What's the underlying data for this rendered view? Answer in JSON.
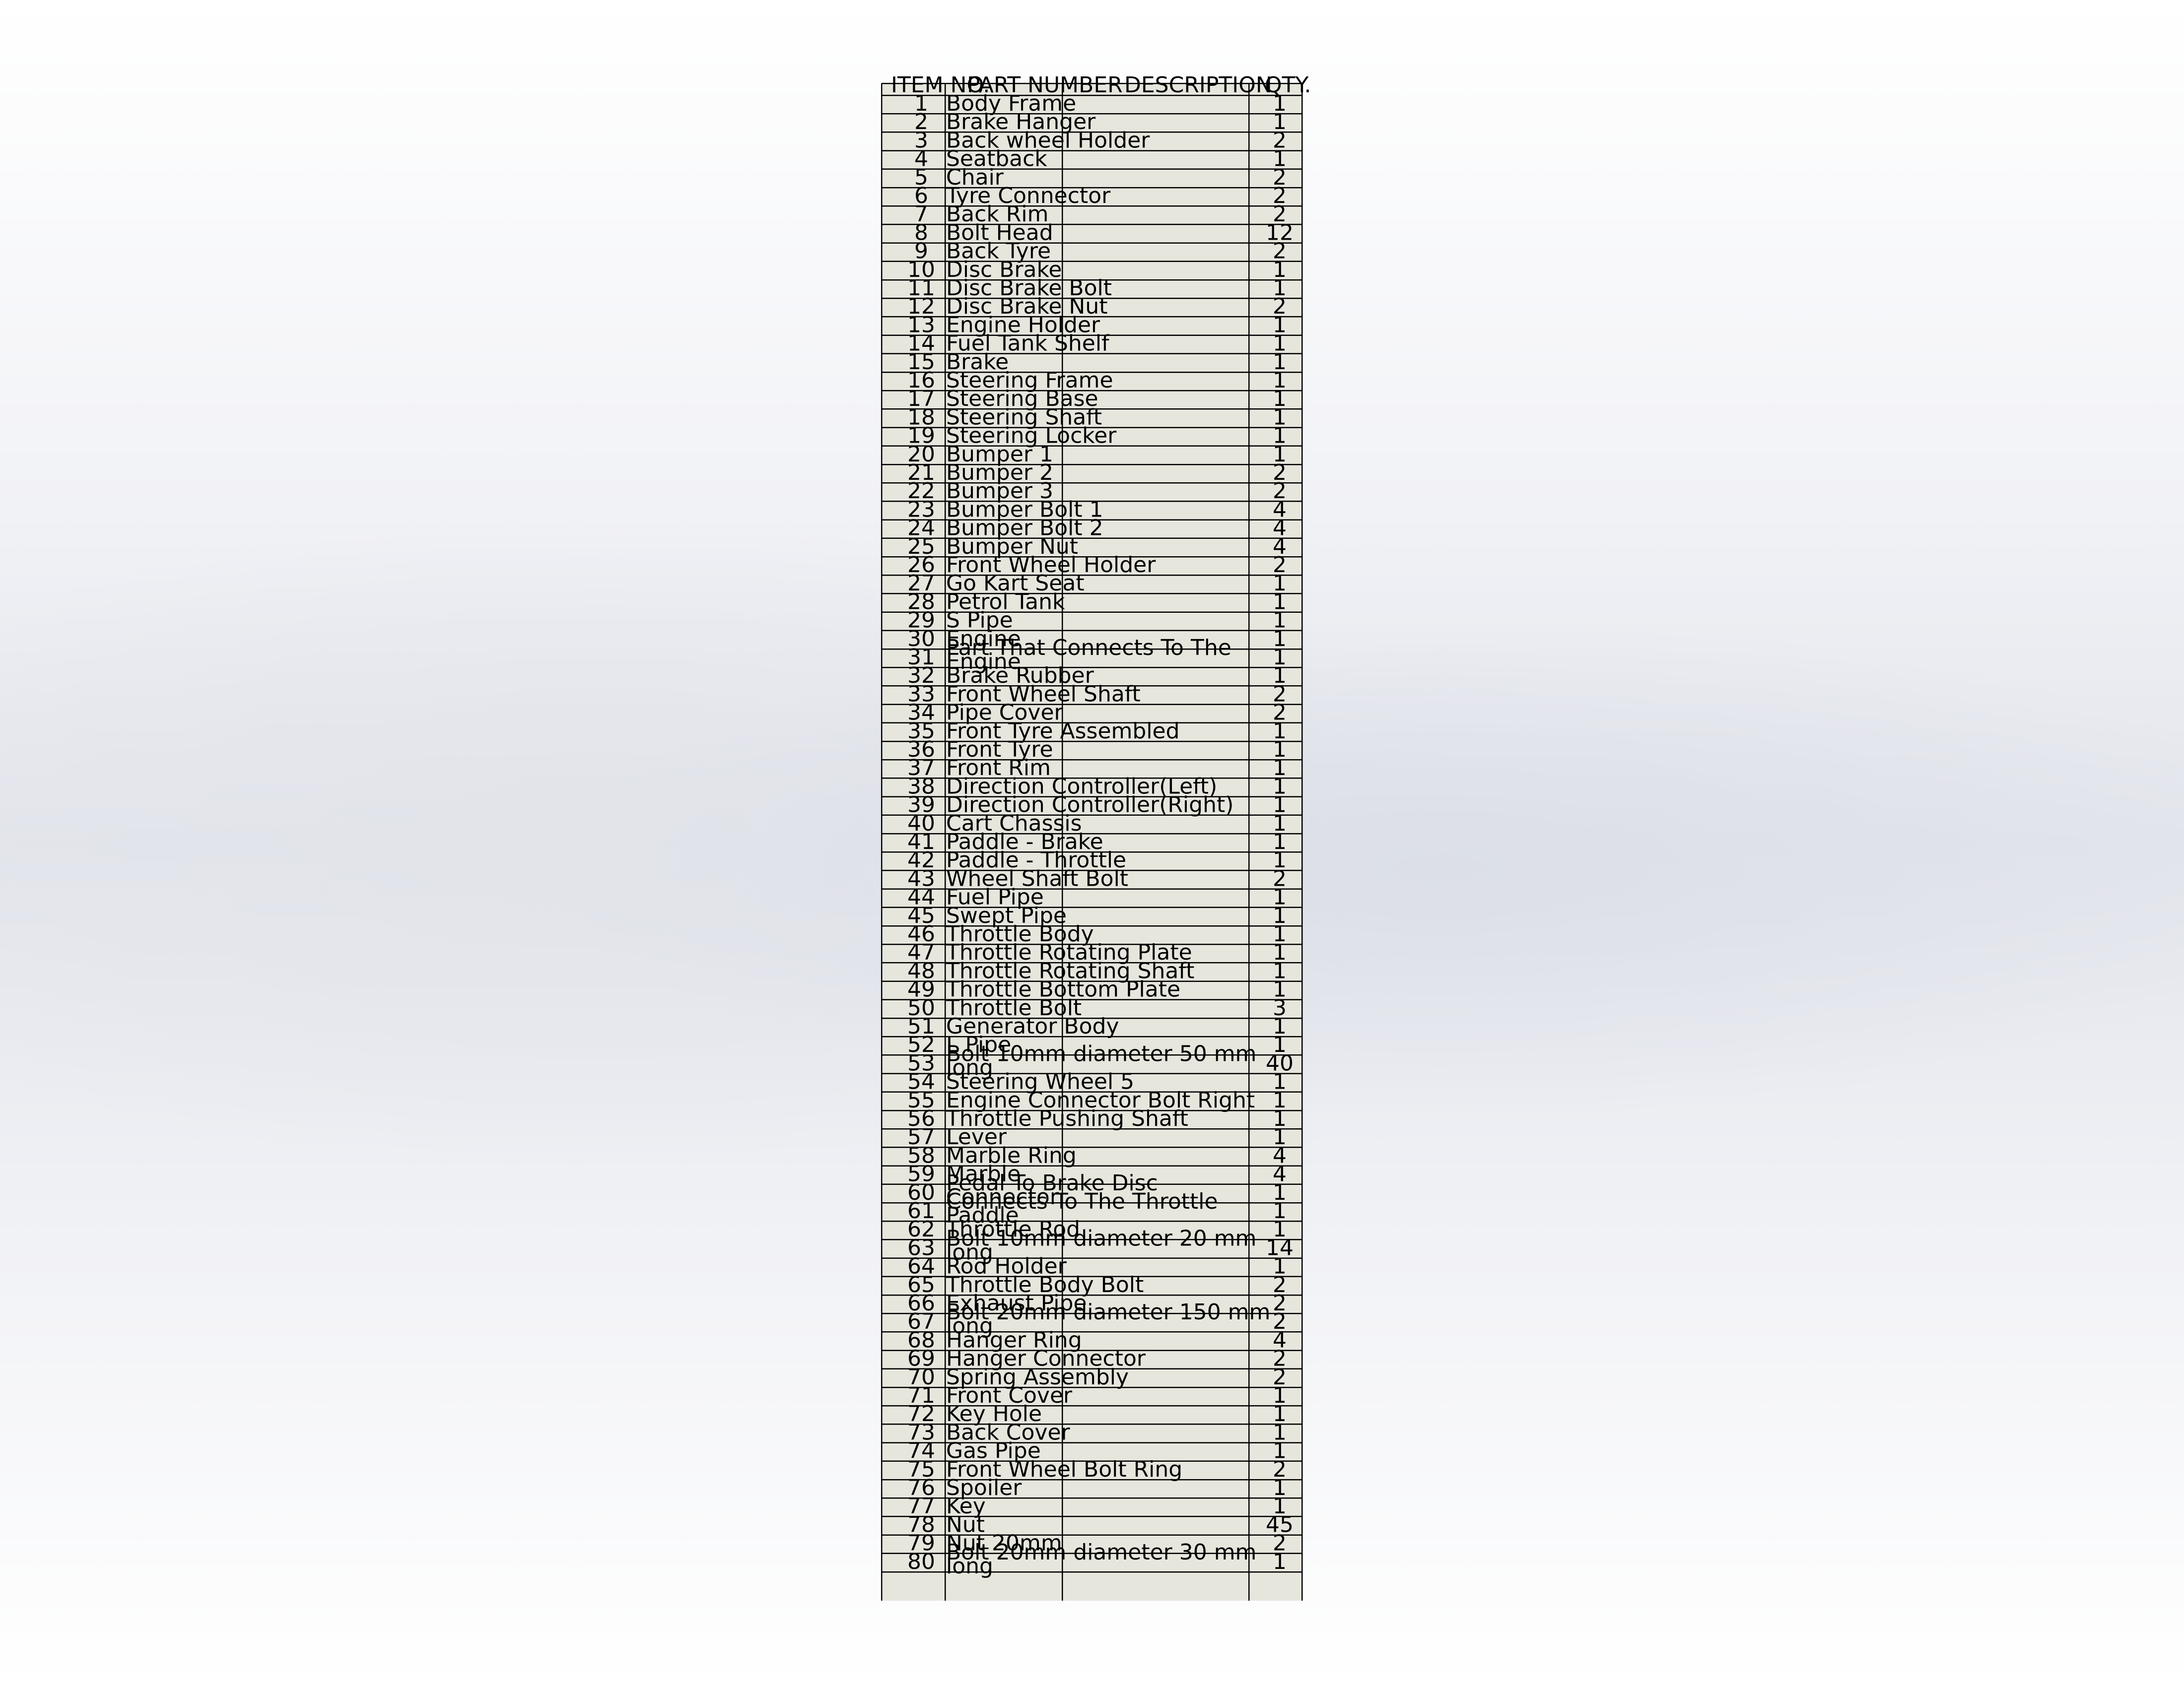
{
  "bom_table": {
    "headers": {
      "item_no": "ITEM NO.",
      "part_number": "PART NUMBER",
      "description": "DESCRIPTION",
      "qty": "QTY."
    },
    "rows": [
      {
        "item": "1",
        "part": "Body Frame",
        "qty": "1"
      },
      {
        "item": "2",
        "part": "Brake Hanger",
        "qty": "1"
      },
      {
        "item": "3",
        "part": "Back wheel Holder",
        "qty": "2"
      },
      {
        "item": "4",
        "part": "Seatback",
        "qty": "1"
      },
      {
        "item": "5",
        "part": "Chair",
        "qty": "2"
      },
      {
        "item": "6",
        "part": "Tyre Connector",
        "qty": "2"
      },
      {
        "item": "7",
        "part": "Back Rim",
        "qty": "2"
      },
      {
        "item": "8",
        "part": "Bolt Head",
        "qty": "12"
      },
      {
        "item": "9",
        "part": "Back Tyre",
        "qty": "2"
      },
      {
        "item": "10",
        "part": "Disc Brake",
        "qty": "1"
      },
      {
        "item": "11",
        "part": "Disc Brake Bolt",
        "qty": "1"
      },
      {
        "item": "12",
        "part": "Disc Brake Nut",
        "qty": "2"
      },
      {
        "item": "13",
        "part": "Engine Holder",
        "qty": "1"
      },
      {
        "item": "14",
        "part": "Fuel Tank Shelf",
        "qty": "1"
      },
      {
        "item": "15",
        "part": "Brake",
        "qty": "1"
      },
      {
        "item": "16",
        "part": "Steering Frame",
        "qty": "1"
      },
      {
        "item": "17",
        "part": "Steering Base",
        "qty": "1"
      },
      {
        "item": "18",
        "part": "Steering Shaft",
        "qty": "1"
      },
      {
        "item": "19",
        "part": "Steering Locker",
        "qty": "1"
      },
      {
        "item": "20",
        "part": "Bumper 1",
        "qty": "1"
      },
      {
        "item": "21",
        "part": "Bumper 2",
        "qty": "2"
      },
      {
        "item": "22",
        "part": "Bumper 3",
        "qty": "2"
      },
      {
        "item": "23",
        "part": "Bumper Bolt 1",
        "qty": "4"
      },
      {
        "item": "24",
        "part": "Bumper Bolt 2",
        "qty": "4"
      },
      {
        "item": "25",
        "part": "Bumper Nut",
        "qty": "4"
      },
      {
        "item": "26",
        "part": "Front Wheel Holder",
        "qty": "2"
      },
      {
        "item": "27",
        "part": "Go Kart Seat",
        "qty": "1"
      },
      {
        "item": "28",
        "part": "Petrol Tank",
        "qty": "1"
      },
      {
        "item": "29",
        "part": "S Pipe",
        "qty": "1"
      },
      {
        "item": "30",
        "part": "Engine",
        "qty": "1"
      },
      {
        "item": "31",
        "part": "Part That Connects To The Engine",
        "qty": "1"
      },
      {
        "item": "32",
        "part": "Brake Rubber",
        "qty": "1"
      },
      {
        "item": "33",
        "part": "Front Wheel Shaft",
        "qty": "2"
      },
      {
        "item": "34",
        "part": "Pipe Cover",
        "qty": "2"
      },
      {
        "item": "35",
        "part": "Front Tyre Assembled",
        "qty": "1"
      },
      {
        "item": "36",
        "part": "Front Tyre",
        "qty": "1"
      },
      {
        "item": "37",
        "part": "Front Rim",
        "qty": "1"
      },
      {
        "item": "38",
        "part": "Direction Controller(Left)",
        "qty": "1"
      },
      {
        "item": "39",
        "part": "Direction Controller(Right)",
        "qty": "1"
      },
      {
        "item": "40",
        "part": "Cart Chassis",
        "qty": "1"
      },
      {
        "item": "41",
        "part": "Paddle - Brake",
        "qty": "1"
      },
      {
        "item": "42",
        "part": "Paddle - Throttle",
        "qty": "1"
      },
      {
        "item": "43",
        "part": "Wheel Shaft Bolt",
        "qty": "2"
      },
      {
        "item": "44",
        "part": "Fuel Pipe",
        "qty": "1"
      },
      {
        "item": "45",
        "part": "Swept Pipe",
        "qty": "1"
      },
      {
        "item": "46",
        "part": "Throttle Body",
        "qty": "1"
      },
      {
        "item": "47",
        "part": "Throttle Rotating Plate",
        "qty": "1"
      },
      {
        "item": "48",
        "part": "Throttle Rotating Shaft",
        "qty": "1"
      },
      {
        "item": "49",
        "part": "Throttle Bottom Plate",
        "qty": "1"
      },
      {
        "item": "50",
        "part": "Throttle Bolt",
        "qty": "3"
      },
      {
        "item": "51",
        "part": "Generator Body",
        "qty": "1"
      },
      {
        "item": "52",
        "part": "L Pipe",
        "qty": "1"
      },
      {
        "item": "53",
        "part": "Bolt 10mm diameter 50 mm long",
        "qty": "40"
      },
      {
        "item": "54",
        "part": "Steering Wheel 5",
        "qty": "1"
      },
      {
        "item": "55",
        "part": "Engine Connector Bolt Right",
        "qty": "1"
      },
      {
        "item": "56",
        "part": "Throttle Pushing Shaft",
        "qty": "1"
      },
      {
        "item": "57",
        "part": "Lever",
        "qty": "1"
      },
      {
        "item": "58",
        "part": "Marble Ring",
        "qty": "4"
      },
      {
        "item": "59",
        "part": "Marble",
        "qty": "4"
      },
      {
        "item": "60",
        "part": "Pedal To Brake Disc Connector",
        "qty": "1"
      },
      {
        "item": "61",
        "part": "Connects To The Throttle Paddle",
        "qty": "1"
      },
      {
        "item": "62",
        "part": "Throttle Rod",
        "qty": "1"
      },
      {
        "item": "63",
        "part": "Bolt 10mm diameter 20 mm long",
        "qty": "14"
      },
      {
        "item": "64",
        "part": "Rod Holder",
        "qty": "1"
      },
      {
        "item": "65",
        "part": "Throttle Body Bolt",
        "qty": "2"
      },
      {
        "item": "66",
        "part": "Exhaust Pipe",
        "qty": "2"
      },
      {
        "item": "67",
        "part": "Bolt 20mm diameter 150 mm long",
        "qty": "2"
      },
      {
        "item": "68",
        "part": "Hanger Ring",
        "qty": "4"
      },
      {
        "item": "69",
        "part": "Hanger Connector",
        "qty": "2"
      },
      {
        "item": "70",
        "part": "Spring Assembly",
        "qty": "2"
      },
      {
        "item": "71",
        "part": "Front Cover",
        "qty": "1"
      },
      {
        "item": "72",
        "part": "Key Hole",
        "qty": "1"
      },
      {
        "item": "73",
        "part": "Back Cover",
        "qty": "1"
      },
      {
        "item": "74",
        "part": "Gas Pipe",
        "qty": "1"
      },
      {
        "item": "75",
        "part": "Front Wheel Bolt Ring",
        "qty": "2"
      },
      {
        "item": "76",
        "part": "Spoiler",
        "qty": "1"
      },
      {
        "item": "77",
        "part": "Key",
        "qty": "1"
      },
      {
        "item": "78",
        "part": "Nut",
        "qty": "45"
      },
      {
        "item": "79",
        "part": "Nut 20mm",
        "qty": "2"
      },
      {
        "item": "80",
        "part": "Bolt 20mm diameter 30 mm long",
        "qty": "1"
      }
    ]
  }
}
